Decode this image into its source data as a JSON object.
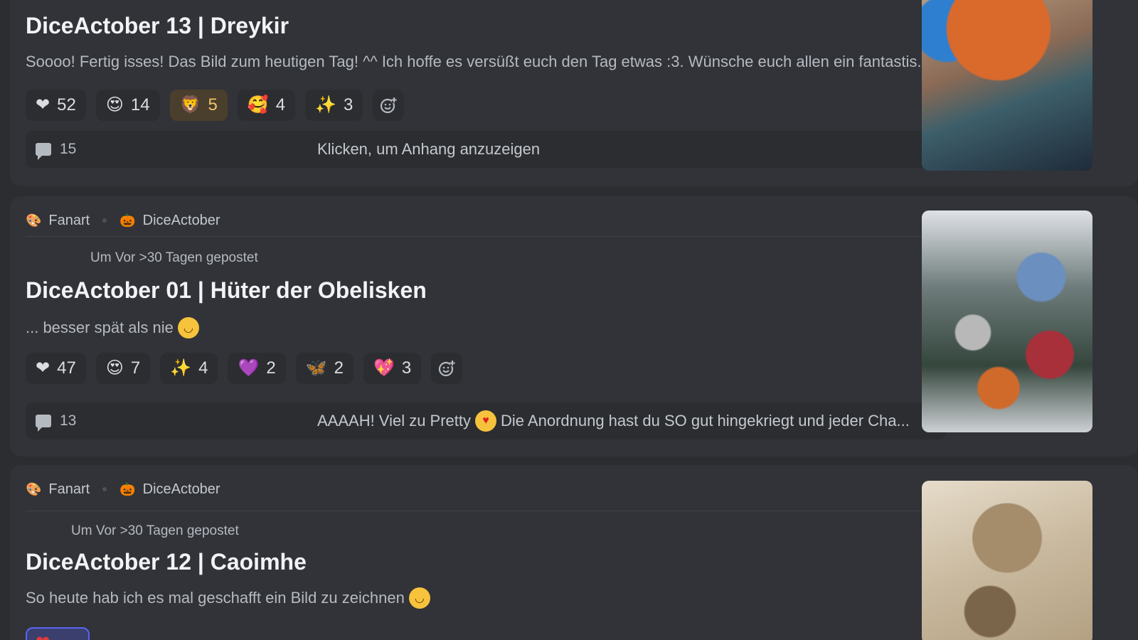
{
  "posts": [
    {
      "title": "DiceActober 13 | Dreykir",
      "snippet": "Soooo! Fertig isses! Das Bild zum heutigen Tag! ^^ Ich hoffe es versüßt euch den Tag etwas :3. Wünsche euch allen ein fantastis...",
      "reactions": [
        {
          "icon": "❤",
          "icon_name": "red-heart-icon",
          "count": "52"
        },
        {
          "icon": "😍",
          "icon_name": "heart-eyes-icon",
          "count": "14"
        },
        {
          "icon": "🦁",
          "icon_name": "lion-icon",
          "count": "5"
        },
        {
          "icon": "🥰",
          "icon_name": "smiling-hearts-icon",
          "count": "4"
        },
        {
          "icon": "✨",
          "icon_name": "sparkles-icon",
          "count": "3"
        }
      ],
      "comment_count": "15",
      "footer_text": "Klicken, um Anhang anzuzeigen"
    },
    {
      "tags": [
        {
          "icon": "🎨",
          "label": "Fanart"
        },
        {
          "icon": "🎃",
          "label": "DiceActober"
        }
      ],
      "meta": "Um Vor >30 Tagen gepostet",
      "title": "DiceActober 01 | Hüter der Obelisken",
      "snippet": "... besser spät als nie",
      "reactions": [
        {
          "icon": "❤",
          "icon_name": "red-heart-icon",
          "count": "47"
        },
        {
          "icon": "😍",
          "icon_name": "heart-eyes-icon",
          "count": "7"
        },
        {
          "icon": "✨",
          "icon_name": "sparkles-icon",
          "count": "4"
        },
        {
          "icon": "💜",
          "icon_name": "purple-heart-icon",
          "count": "2"
        },
        {
          "icon": "🦋",
          "icon_name": "butterfly-icon",
          "count": "2"
        },
        {
          "icon": "💖",
          "icon_name": "sparkling-heart-icon",
          "count": "3"
        }
      ],
      "comment_count": "13",
      "footer_text_before": "AAAAH! Viel zu Pretty",
      "footer_text_after": "Die Anordnung hast du SO gut hingekriegt und jeder Cha..."
    },
    {
      "tags": [
        {
          "icon": "🎨",
          "label": "Fanart"
        },
        {
          "icon": "🎃",
          "label": "DiceActober"
        }
      ],
      "meta": "Um Vor >30 Tagen gepostet",
      "title": "DiceActober 12 | Caoimhe",
      "snippet": "So heute hab ich es mal geschafft ein Bild zu zeichnen"
    }
  ],
  "colors": {
    "background": "#2b2d31",
    "card": "#313338",
    "accent": "#5865f2",
    "active_reaction": "#4a3f2c"
  }
}
